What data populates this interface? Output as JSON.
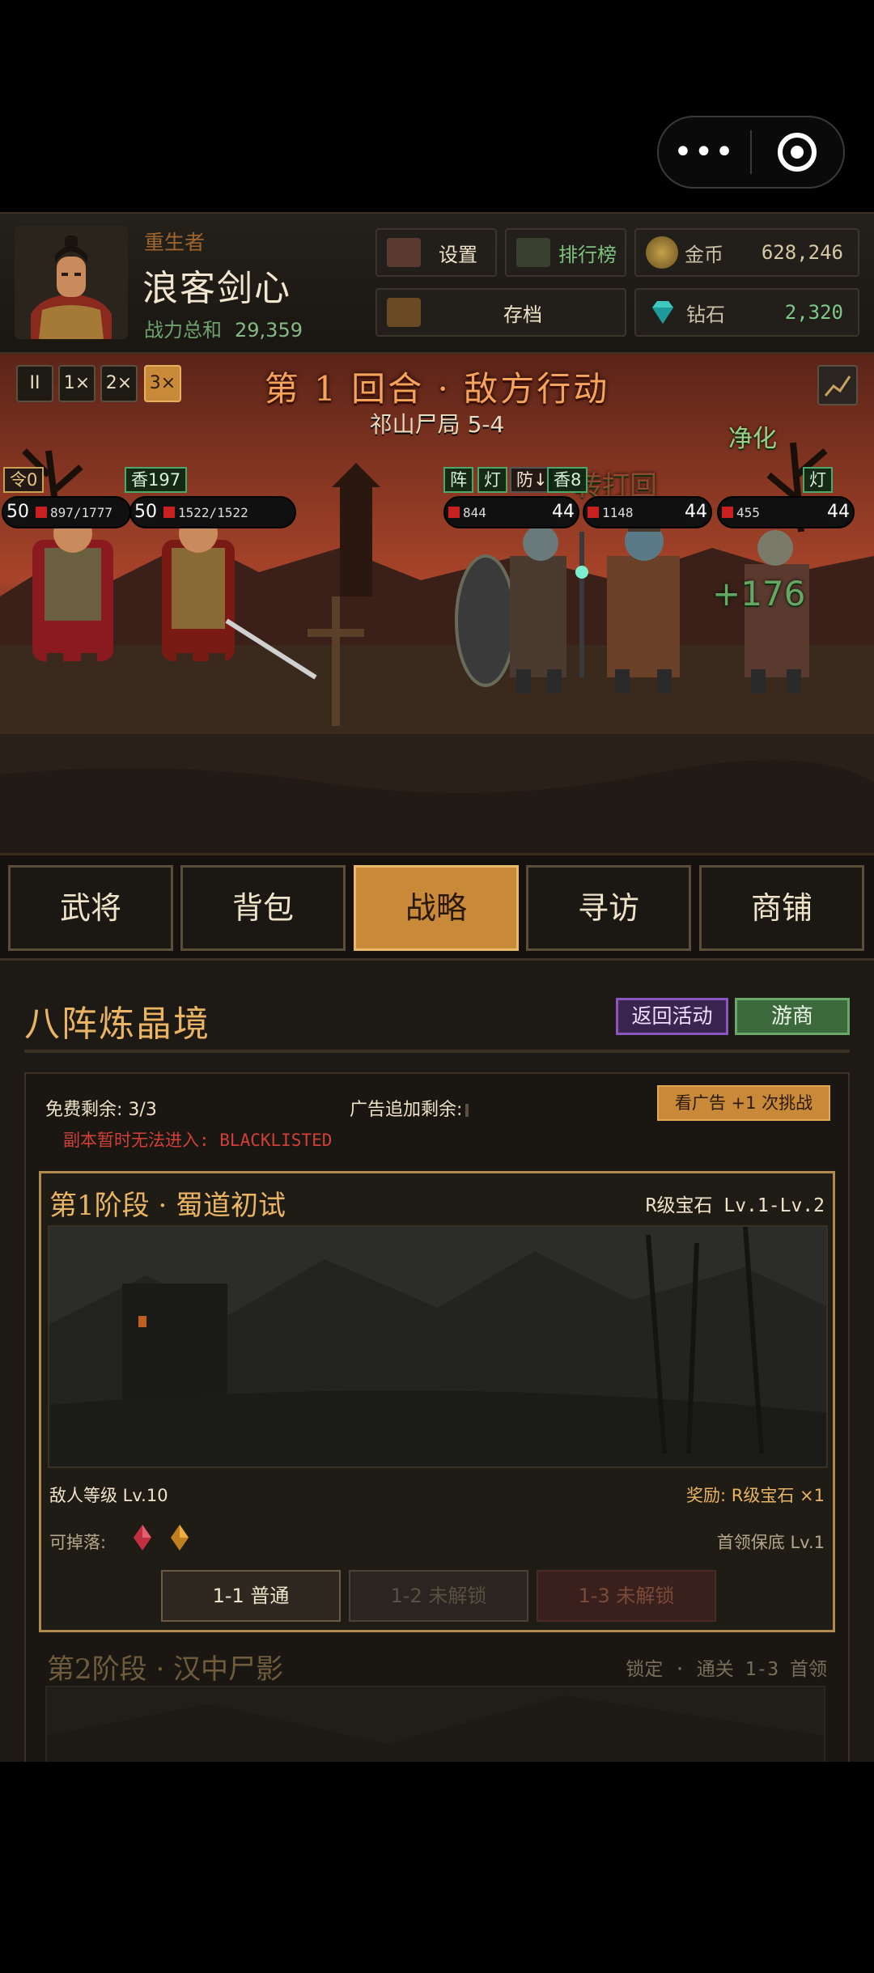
{
  "topbar": {
    "more_glyph": "•••",
    "target_icon": "target-icon"
  },
  "player": {
    "tag": "重生者",
    "name": "浪客剑心",
    "power_label": "战力总和",
    "power_value": "29,359"
  },
  "header_buttons": {
    "settings": "设置",
    "leaderboard": "排行榜",
    "save": "存档",
    "gold_label": "金币",
    "gold_value": "628,246",
    "diamond_label": "钻石",
    "diamond_value": "2,320"
  },
  "battle": {
    "speed": [
      "II",
      "1×",
      "2×",
      "3×"
    ],
    "active_speed": "3×",
    "turn_text": "第 1 回合 · 敌方行动",
    "stage_text": "祁山尸局 5-4",
    "floating": {
      "purify": "净化",
      "heal": "+176",
      "ghost": "转打回",
      "ghost2": "防"
    },
    "allies": [
      {
        "tag": "令0",
        "level": "50",
        "hp": "897/1777",
        "hp_ratio": 0.5
      },
      {
        "tag": "香197",
        "level": "50",
        "hp": "1522/1522",
        "hp_ratio": 1.0
      }
    ],
    "enemy_tags": [
      "阵",
      "灯",
      "防↓",
      "香8",
      "灯"
    ],
    "enemies": [
      {
        "level": "44",
        "hp": "844"
      },
      {
        "level": "44",
        "hp": "1148"
      },
      {
        "level": "44",
        "hp": "455"
      }
    ]
  },
  "tabs": [
    "武将",
    "背包",
    "战略",
    "寻访",
    "商铺"
  ],
  "active_tab": "战略",
  "panel": {
    "title": "八阵炼晶境",
    "return_button": "返回活动",
    "trader_button": "游商",
    "free_left": "免费剩余: 3/3",
    "ad_left": "广告追加剩余:",
    "ad_button": "看广告 +1 次挑战",
    "blacklist": "副本暂时无法进入: BLACKLISTED",
    "stage1": {
      "title": "第1阶段 · 蜀道初试",
      "gem_range": "R级宝石 Lv.1-Lv.2",
      "enemy_level": "敌人等级 Lv.10",
      "reward": "奖励: R级宝石 ×1",
      "drops_label": "可掉落:",
      "boss_note": "首领保底 Lv.1",
      "levels": [
        "1-1  普通",
        "1-2  未解锁",
        "1-3  未解锁"
      ]
    },
    "stage2": {
      "title": "第2阶段 · 汉中尸影",
      "lock_note": "锁定 · 通关 1-3 首领"
    }
  }
}
